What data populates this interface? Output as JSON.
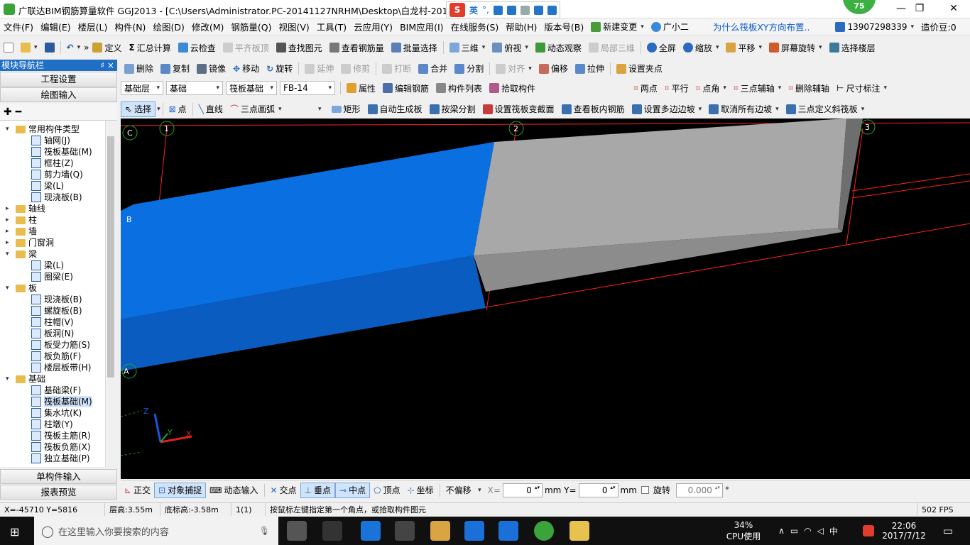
{
  "window": {
    "title": "广联达BIM钢筋算量软件 GGJ2013 - [C:\\Users\\Administrator.PC-20141127NRHM\\Desktop\\白龙村-2016-08-",
    "badge": "75"
  },
  "ime": {
    "logo": "S",
    "lang": "英",
    "punct": "°,"
  },
  "menu": {
    "items": [
      "文件(F)",
      "编辑(E)",
      "楼层(L)",
      "构件(N)",
      "绘图(D)",
      "修改(M)",
      "钢筋量(Q)",
      "视图(V)",
      "工具(T)",
      "云应用(Y)",
      "BIM应用(I)",
      "在线服务(S)",
      "帮助(H)",
      "版本号(B)"
    ],
    "new_change": "新建变更",
    "assistant": "广小二",
    "question_link": "为什么筏板XY方向布置..",
    "phone": "13907298339",
    "cost_beans": "造价豆:0"
  },
  "toolbar1": [
    "定义",
    "汇总计算",
    "云检查",
    "平齐板顶",
    "查找图元",
    "查看钢筋量",
    "批量选择",
    "三维",
    "俯视",
    "动态观察",
    "局部三维",
    "全屏",
    "缩放",
    "平移",
    "屏幕旋转",
    "选择楼层"
  ],
  "toolbar2": [
    "删除",
    "复制",
    "镜像",
    "移动",
    "旋转",
    "延伸",
    "修剪",
    "打断",
    "合并",
    "分割",
    "对齐",
    "偏移",
    "拉伸",
    "设置夹点"
  ],
  "toolbar3": {
    "floor_type": "基础层",
    "category": "基础",
    "component_type": "筏板基础",
    "component_name": "FB-14",
    "buttons": [
      "属性",
      "编辑钢筋",
      "构件列表",
      "拾取构件"
    ],
    "axis_tools": [
      "两点",
      "平行",
      "点角",
      "三点辅轴",
      "删除辅轴",
      "尺寸标注"
    ]
  },
  "toolbar4": [
    "选择",
    "点",
    "直线",
    "三点画弧",
    "矩形",
    "自动生成板",
    "按梁分割",
    "设置筏板变截面",
    "查看板内钢筋",
    "设置多边边坡",
    "取消所有边坡",
    "三点定义斜筏板"
  ],
  "nav": {
    "title": "模块导航栏",
    "pin": "♯ ×",
    "project_settings": "工程设置",
    "drawing_input": "绘图输入",
    "single_input": "单构件输入",
    "report_preview": "报表预览"
  },
  "tree": [
    {
      "label": "常用构件类型",
      "level": 0,
      "folder": true,
      "open": true
    },
    {
      "label": "轴网(J)",
      "level": 1
    },
    {
      "label": "筏板基础(M)",
      "level": 1
    },
    {
      "label": "框柱(Z)",
      "level": 1
    },
    {
      "label": "剪力墙(Q)",
      "level": 1
    },
    {
      "label": "梁(L)",
      "level": 1
    },
    {
      "label": "现浇板(B)",
      "level": 1
    },
    {
      "label": "轴线",
      "level": 0,
      "folder": true,
      "open": false
    },
    {
      "label": "柱",
      "level": 0,
      "folder": true,
      "open": false
    },
    {
      "label": "墙",
      "level": 0,
      "folder": true,
      "open": false
    },
    {
      "label": "门窗洞",
      "level": 0,
      "folder": true,
      "open": false
    },
    {
      "label": "梁",
      "level": 0,
      "folder": true,
      "open": true
    },
    {
      "label": "梁(L)",
      "level": 1
    },
    {
      "label": "圈梁(E)",
      "level": 1
    },
    {
      "label": "板",
      "level": 0,
      "folder": true,
      "open": true
    },
    {
      "label": "现浇板(B)",
      "level": 1
    },
    {
      "label": "螺旋板(B)",
      "level": 1
    },
    {
      "label": "柱帽(V)",
      "level": 1
    },
    {
      "label": "板洞(N)",
      "level": 1
    },
    {
      "label": "板受力筋(S)",
      "level": 1
    },
    {
      "label": "板负筋(F)",
      "level": 1
    },
    {
      "label": "楼层板带(H)",
      "level": 1
    },
    {
      "label": "基础",
      "level": 0,
      "folder": true,
      "open": true
    },
    {
      "label": "基础梁(F)",
      "level": 1
    },
    {
      "label": "筏板基础(M)",
      "level": 1,
      "selected": true
    },
    {
      "label": "集水坑(K)",
      "level": 1
    },
    {
      "label": "柱墩(Y)",
      "level": 1
    },
    {
      "label": "筏板主筋(R)",
      "level": 1
    },
    {
      "label": "筏板负筋(X)",
      "level": 1
    },
    {
      "label": "独立基础(P)",
      "level": 1
    }
  ],
  "canvas": {
    "axis_labels": [
      "C",
      "1",
      "2",
      "3",
      "B",
      "A"
    ],
    "z_label": "Z",
    "y_label": "Y",
    "x_label": "X",
    "colors": {
      "selected_slab": "#0a6fe0",
      "slab": "#a8a8a8",
      "axis_line": "#ff2020",
      "grid_circle": "#22aa22"
    }
  },
  "snap": {
    "ortho": "正交",
    "object_snap": "对象捕捉",
    "dynamic_input": "动态输入",
    "intersection": "交点",
    "perpendicular": "垂点",
    "midpoint": "中点",
    "vertex": "顶点",
    "coordinate": "坐标",
    "offset_mode": "不偏移",
    "x_label": "X=",
    "x_value": "0",
    "y_label": "mm  Y=",
    "y_value": "0",
    "unit": "mm",
    "rotate_label": "旋转",
    "rotate_value": "0.000",
    "degree": "°"
  },
  "status": {
    "coords": "X=-45710  Y=5816",
    "floor_height": "层高:3.55m",
    "bottom_elev": "底标高:-3.58m",
    "count": "1(1)",
    "hint": "按鼠标左键指定第一个角点，或拾取构件图元",
    "fps": "502 FPS"
  },
  "taskbar": {
    "search_placeholder": "在这里输入你要搜索的内容",
    "cpu_percent": "34%",
    "cpu_label": "CPU使用",
    "ime": "中",
    "time": "22:06",
    "date": "2017/7/12"
  }
}
